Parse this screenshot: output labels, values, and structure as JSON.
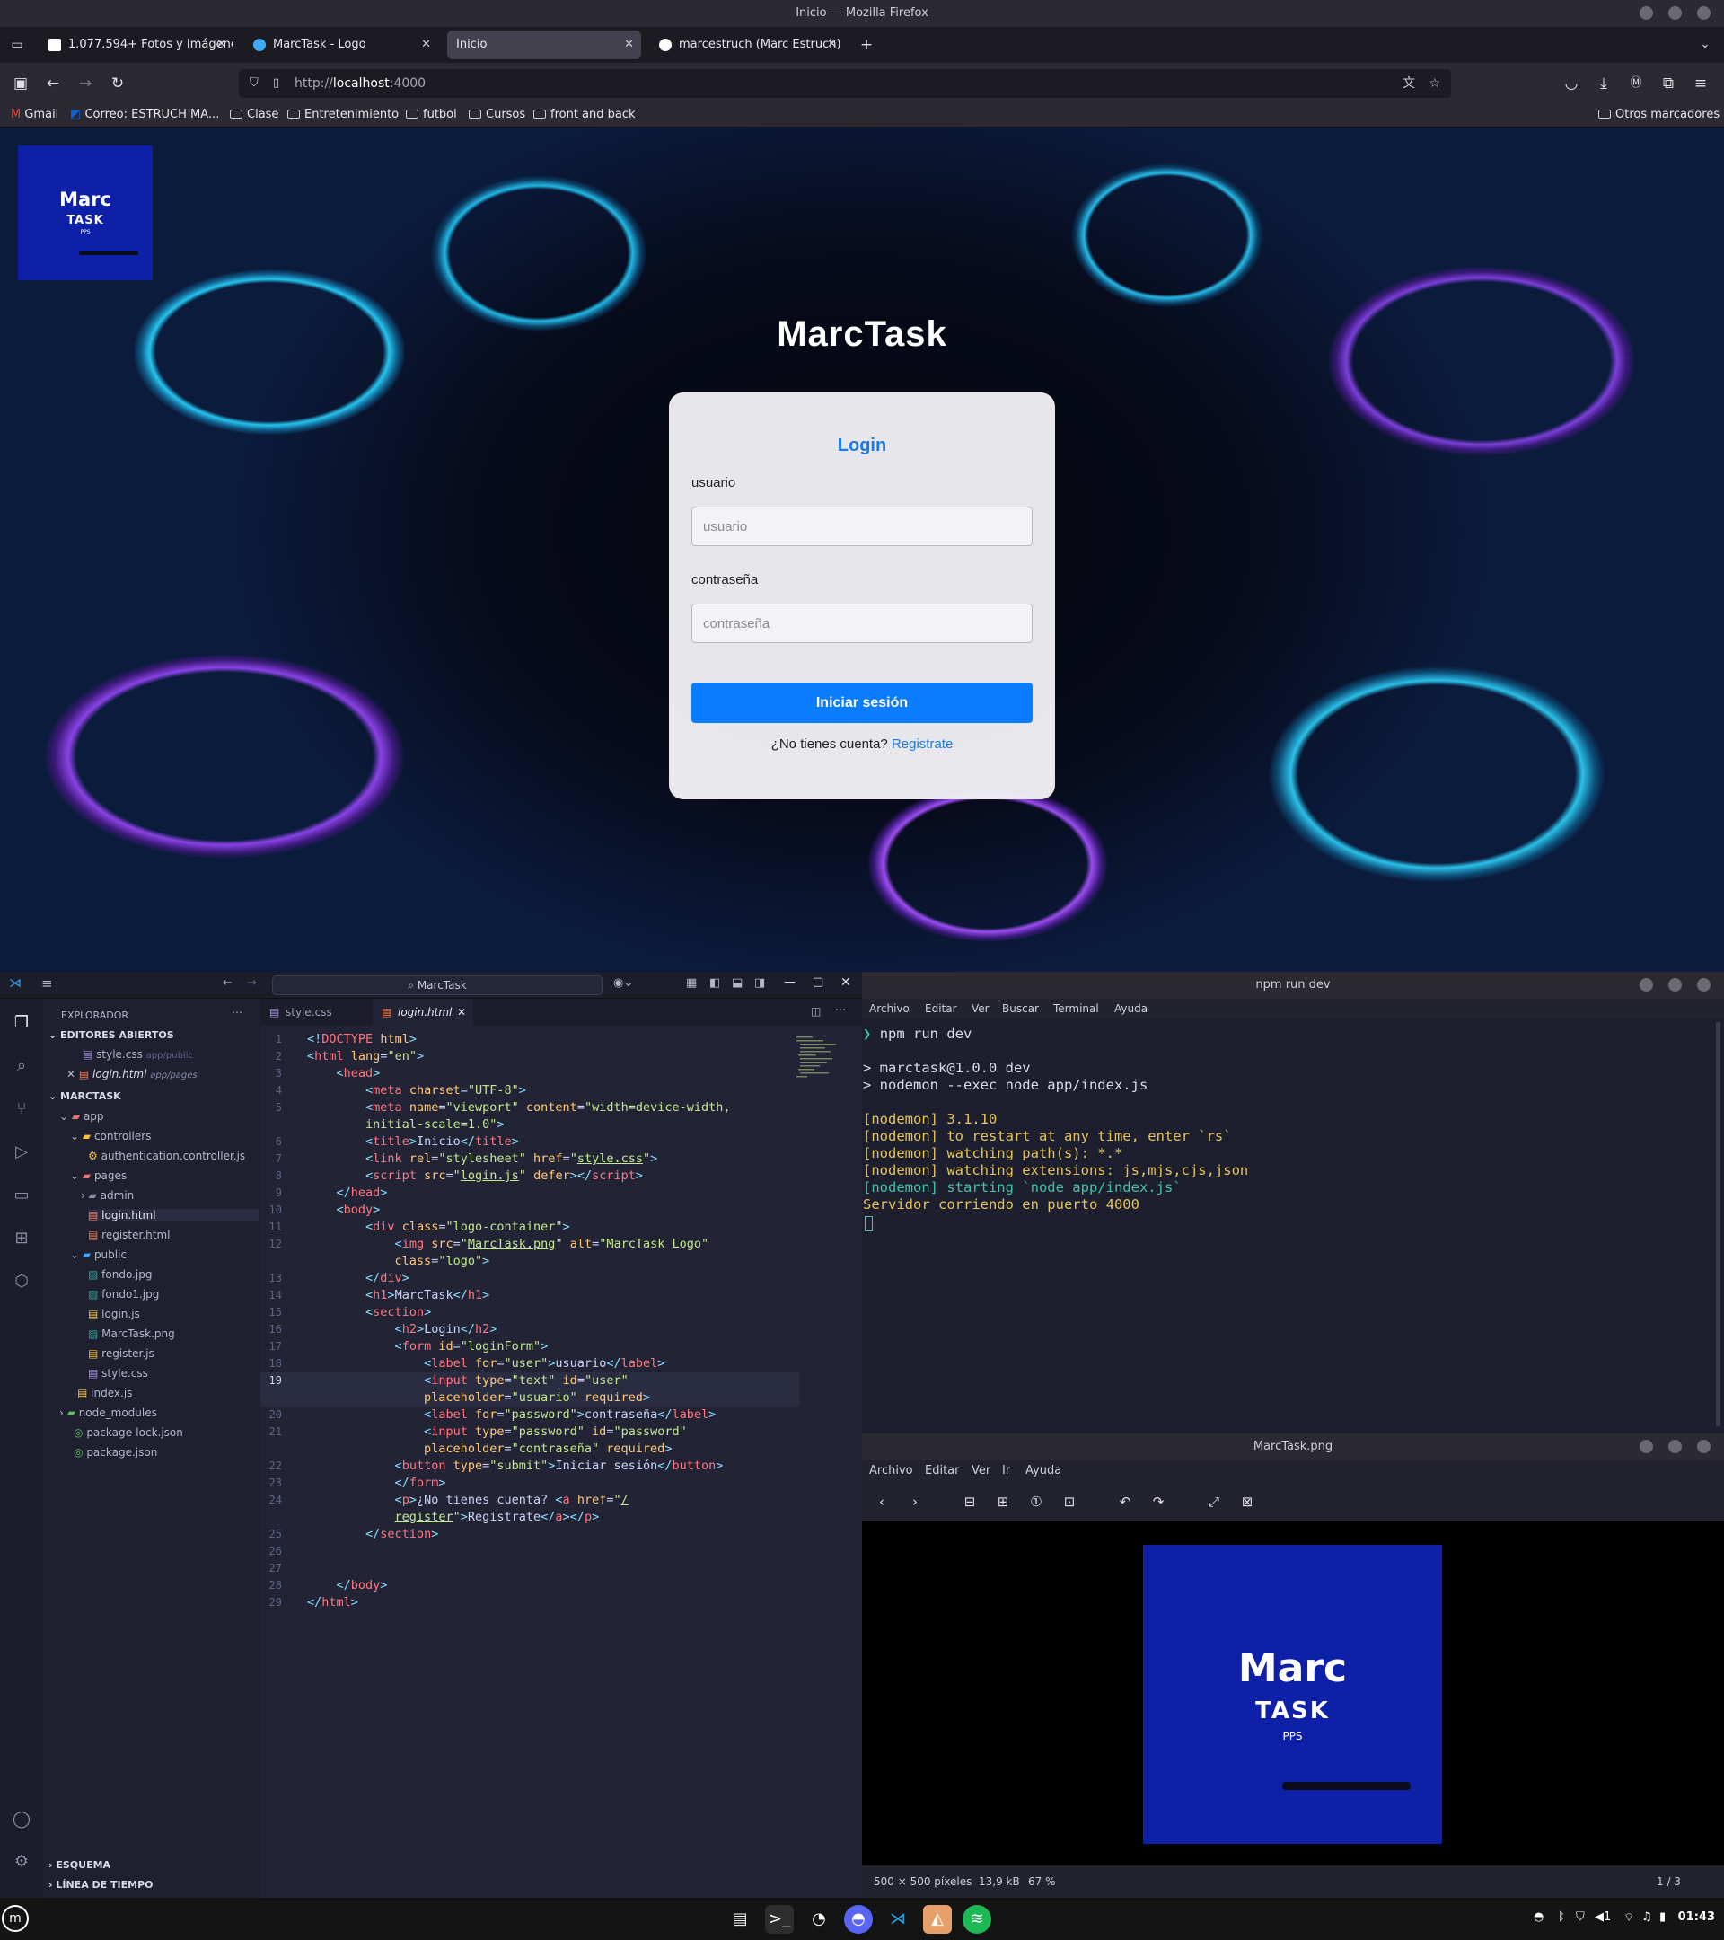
{
  "window": {
    "title": "Inicio — Mozilla Firefox"
  },
  "tabs": [
    {
      "label": "1.077.594+ Fotos y Imágenes"
    },
    {
      "label": "MarcTask - Logo"
    },
    {
      "label": "Inicio"
    },
    {
      "label": "marcestruch (Marc Estruch)"
    }
  ],
  "url": {
    "scheme": "http://",
    "host": "localhost",
    "port": ":4000"
  },
  "bookmarks": [
    "Gmail",
    "Correo: ESTRUCH MA...",
    "Clase",
    "Entretenimiento",
    "futbol",
    "Cursos",
    "front and back"
  ],
  "bookmarks_other": "Otros marcadores",
  "page": {
    "logo": {
      "marc": "Marc",
      "task": "TASK",
      "pps": "PPS"
    },
    "heading": "MarcTask",
    "login": {
      "title": "Login",
      "user_label": "usuario",
      "user_placeholder": "usuario",
      "pass_label": "contraseña",
      "pass_placeholder": "contraseña",
      "button": "Iniciar sesión",
      "no_account": "¿No tienes cuenta?",
      "register_link": "Registrate"
    }
  },
  "vscode": {
    "search": "MarcTask",
    "explorer_title": "EXPLORADOR",
    "open_editors_title": "EDITORES ABIERTOS",
    "open_editors": [
      {
        "name": "style.css",
        "path": "app/public"
      },
      {
        "name": "login.html",
        "path": "app/pages"
      }
    ],
    "project": "MARCTASK",
    "tree": [
      "app",
      "controllers",
      "authentication.controller.js",
      "pages",
      "admin",
      "login.html",
      "register.html",
      "public",
      "fondo.jpg",
      "fondo1.jpg",
      "login.js",
      "MarcTask.png",
      "register.js",
      "style.css",
      "index.js",
      "node_modules",
      "package-lock.json",
      "package.json"
    ],
    "outline": "ESQUEMA",
    "timeline": "LÍNEA DE TIEMPO",
    "tabs": [
      "style.css",
      "login.html"
    ],
    "line_numbers": [
      "1",
      "2",
      "3",
      "4",
      "5",
      "",
      "6",
      "7",
      "8",
      "9",
      "10",
      "11",
      "12",
      "",
      "13",
      "14",
      "15",
      "16",
      "17",
      "18",
      "19",
      "",
      "20",
      "21",
      "",
      "22",
      "23",
      "24",
      "",
      "25",
      "26",
      "27",
      "28",
      "29"
    ]
  },
  "terminal": {
    "title": "npm run dev",
    "menu": [
      "Archivo",
      "Editar",
      "Ver",
      "Buscar",
      "Terminal",
      "Ayuda"
    ],
    "lines": [
      "❯ npm run dev",
      "",
      "> marctask@1.0.0 dev",
      "> nodemon --exec node app/index.js",
      "",
      "[nodemon] 3.1.10",
      "[nodemon] to restart at any time, enter `rs`",
      "[nodemon] watching path(s): *.*",
      "[nodemon] watching extensions: js,mjs,cjs,json",
      "[nodemon] starting `node app/index.js`",
      "Servidor corriendo en puerto 4000"
    ]
  },
  "viewer": {
    "title": "MarcTask.png",
    "menu": [
      "Archivo",
      "Editar",
      "Ver",
      "Ir",
      "Ayuda"
    ],
    "image": {
      "marc": "Marc",
      "task": "TASK",
      "pps": "PPS"
    },
    "status_dims": "500 × 500 píxeles",
    "status_size": "13,9 kB",
    "status_zoom": "67 %",
    "status_page": "1 / 3"
  },
  "taskbar": {
    "clock": "01:43",
    "volume": "1"
  },
  "colors": {
    "accent": "#0a7cff",
    "logo_bg": "#0e1fa8",
    "link": "#1a7be6"
  }
}
